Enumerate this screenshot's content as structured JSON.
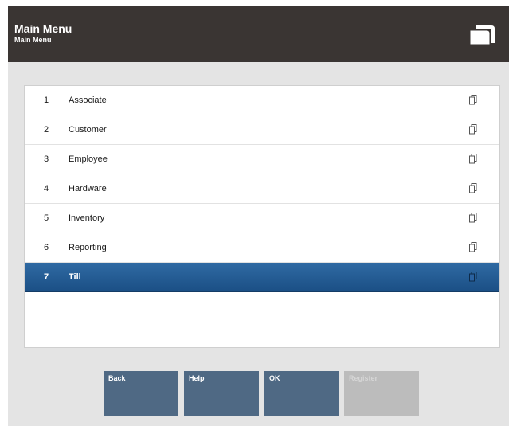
{
  "header": {
    "title": "Main Menu",
    "subtitle": "Main Menu"
  },
  "menu": {
    "items": [
      {
        "number": "1",
        "label": "Associate",
        "selected": false
      },
      {
        "number": "2",
        "label": "Customer",
        "selected": false
      },
      {
        "number": "3",
        "label": "Employee",
        "selected": false
      },
      {
        "number": "4",
        "label": "Hardware",
        "selected": false
      },
      {
        "number": "5",
        "label": "Inventory",
        "selected": false
      },
      {
        "number": "6",
        "label": "Reporting",
        "selected": false
      },
      {
        "number": "7",
        "label": "Till",
        "selected": true
      }
    ],
    "row_icon": "submenu-icon"
  },
  "buttons": {
    "back": "Back",
    "help": "Help",
    "ok": "OK",
    "register": "Register"
  },
  "colors": {
    "header_bg": "#3a3533",
    "selected_row": "#1f578e",
    "button_bg": "#4f6984",
    "button_disabled": "#bcbcbc"
  }
}
